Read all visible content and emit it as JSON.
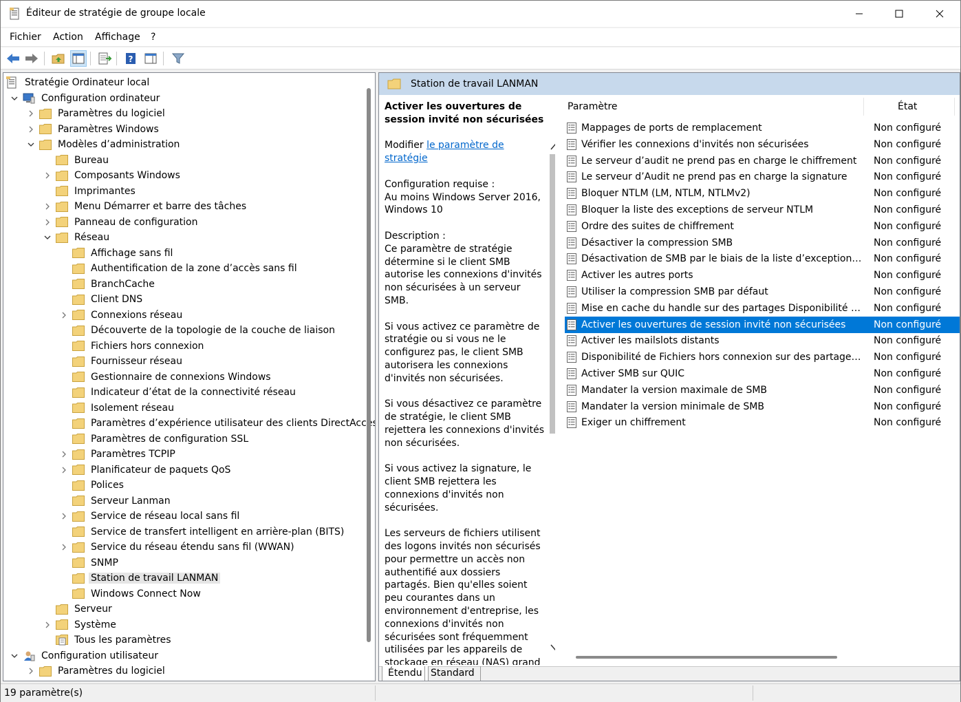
{
  "window": {
    "title": "Éditeur de stratégie de groupe locale"
  },
  "menu": [
    "Fichier",
    "Action",
    "Affichage",
    "?"
  ],
  "tree": {
    "root": "Stratégie Ordinateur local",
    "computer_config": "Configuration ordinateur",
    "software_settings": "Paramètres du logiciel",
    "windows_settings": "Paramètres Windows",
    "admin_templates": "Modèles d’administration",
    "desktop": "Bureau",
    "windows_components": "Composants Windows",
    "printers": "Imprimantes",
    "start_menu": "Menu Démarrer et barre des tâches",
    "control_panel": "Panneau de configuration",
    "network": "Réseau",
    "network_items": [
      "Affichage sans fil",
      "Authentification de la zone d’accès sans fil",
      "BranchCache",
      "Client DNS",
      "Connexions réseau",
      "Découverte de la topologie de la couche de liaison",
      "Fichiers hors connexion",
      "Fournisseur réseau",
      "Gestionnaire de connexions Windows",
      "Indicateur d’état de la connectivité réseau",
      "Isolement réseau",
      "Paramètres d’expérience utilisateur des clients DirectAccess",
      "Paramètres de configuration SSL",
      "Paramètres TCPIP",
      "Planificateur de paquets QoS",
      "Polices",
      "Serveur Lanman",
      "Service de réseau local sans fil",
      "Service de transfert intelligent en arrière-plan (BITS)",
      "Service du réseau étendu sans fil (WWAN)",
      "SNMP",
      "Station de travail LANMAN",
      "Windows Connect Now"
    ],
    "server": "Serveur",
    "system": "Système",
    "all_settings": "Tous les paramètres",
    "user_config": "Configuration utilisateur",
    "user_software_settings": "Paramètres du logiciel"
  },
  "right": {
    "header": "Station de travail LANMAN",
    "description": {
      "title": "Activer les ouvertures de session invité non sécurisées",
      "edit_prefix": "Modifier ",
      "edit_link": "le paramètre de stratégie",
      "requirements_label": "Configuration requise :",
      "requirements": "Au moins Windows Server 2016, Windows 10",
      "description_label": "Description :",
      "p1": "Ce paramètre de stratégie détermine si le client SMB autorise les connexions d'invités non sécurisées à un serveur SMB.",
      "p2": "Si vous activez ce paramètre de stratégie ou si vous ne le configurez pas, le client SMB autorisera les connexions d'invités non sécurisées.",
      "p3": "Si vous désactivez ce paramètre de stratégie, le client SMB rejettera les connexions d'invités non sécurisées.",
      "p4": "Si vous activez la signature, le client SMB rejettera les connexions d'invités non sécurisées.",
      "p5": "Les serveurs de fichiers utilisent des logons invités non sécurisés pour permettre un accès non authentifié aux dossiers partagés. Bien qu'elles soient peu courantes dans un environnement d'entreprise, les connexions d'invités non sécurisées sont fréquemment utilisées par les appareils de stockage en réseau (NAS) grand public qui font office de serveurs de fichiers. Les serveurs de fichiers Windows requièrent une authentification et"
    },
    "columns": {
      "setting": "Paramètre",
      "state": "État"
    },
    "rows": [
      {
        "name": "Mappages de ports de remplacement",
        "state": "Non configuré"
      },
      {
        "name": "Vérifier les connexions d'invités non sécurisées",
        "state": "Non configuré"
      },
      {
        "name": "Le serveur d’audit ne prend pas en charge le chiffrement",
        "state": "Non configuré"
      },
      {
        "name": "Le serveur d’Audit ne prend pas en charge la signature",
        "state": "Non configuré"
      },
      {
        "name": "Bloquer NTLM (LM, NTLM, NTLMv2)",
        "state": "Non configuré"
      },
      {
        "name": "Bloquer la liste des exceptions de serveur NTLM",
        "state": "Non configuré"
      },
      {
        "name": "Ordre des suites de chiffrement",
        "state": "Non configuré"
      },
      {
        "name": "Désactiver la compression SMB",
        "state": "Non configuré"
      },
      {
        "name": "Désactivation de SMB par le biais de la liste d’exceptions du s...",
        "state": "Non configuré"
      },
      {
        "name": "Activer les autres ports",
        "state": "Non configuré"
      },
      {
        "name": "Utiliser la compression SMB par défaut",
        "state": "Non configuré"
      },
      {
        "name": "Mise en cache du handle sur des partages Disponibilité conti...",
        "state": "Non configuré"
      },
      {
        "name": "Activer les ouvertures de session invité non sécurisées",
        "state": "Non configuré"
      },
      {
        "name": "Activer les mailslots distants",
        "state": "Non configuré"
      },
      {
        "name": "Disponibilité de Fichiers hors connexion sur des partages ave...",
        "state": "Non configuré"
      },
      {
        "name": "Activer SMB sur QUIC",
        "state": "Non configuré"
      },
      {
        "name": "Mandater la version maximale de SMB",
        "state": "Non configuré"
      },
      {
        "name": "Mandater la version minimale de SMB",
        "state": "Non configuré"
      },
      {
        "name": "Exiger un chiffrement",
        "state": "Non configuré"
      }
    ],
    "selected_index": 12,
    "tabs": [
      "Étendu",
      "Standard"
    ]
  },
  "status": "19 paramètre(s)",
  "colors": {
    "selection": "#0078d7",
    "header": "#c7d9ec",
    "folder": "#f3d27a"
  }
}
